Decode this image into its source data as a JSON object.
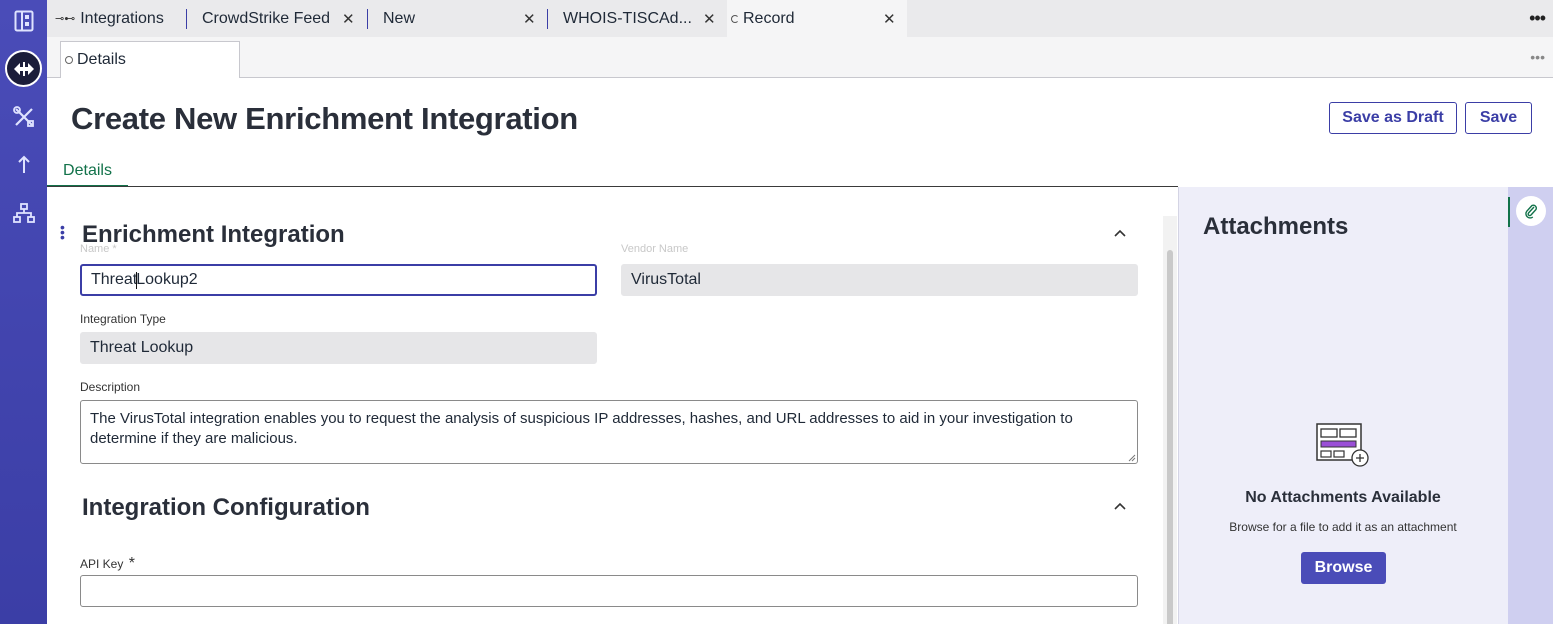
{
  "tabs": [
    {
      "label": "Integrations",
      "icon": "integration-icon",
      "closable": false
    },
    {
      "label": "CrowdStrike Feed",
      "closable": true
    },
    {
      "label": "New",
      "closable": true
    },
    {
      "label": "WHOIS-TISCAd...",
      "closable": true
    },
    {
      "label": "Record",
      "icon": "loading-icon",
      "closable": true,
      "active": true
    }
  ],
  "subtab": {
    "label": "Details"
  },
  "page": {
    "title": "Create New Enrichment Integration",
    "save_draft_label": "Save as Draft",
    "save_label": "Save",
    "detail_tab_label": "Details"
  },
  "enrichment": {
    "section_title": "Enrichment Integration",
    "name_label": "Name *",
    "name_value_before_caret": "Threat",
    "name_value_after_caret": "Lookup2",
    "vendor_label": "Vendor Name",
    "vendor_value": "VirusTotal",
    "type_label": "Integration Type",
    "type_value": "Threat Lookup",
    "description_label": "Description",
    "description_value": "The VirusTotal integration enables you to request the analysis of suspicious IP addresses, hashes, and URL addresses to aid in your investigation to determine if they are malicious."
  },
  "configuration": {
    "section_title": "Integration Configuration",
    "api_key_label": "API Key",
    "api_key_required": "*",
    "api_key_value": ""
  },
  "attachments": {
    "title": "Attachments",
    "empty_title": "No Attachments Available",
    "empty_hint": "Browse for a file to add it as an attachment",
    "browse_label": "Browse"
  },
  "colors": {
    "accent": "#3b3ea6",
    "active_tab_text": "#12724a",
    "rail": "#4a4cb8",
    "attach_bg": "#eeeef9"
  }
}
